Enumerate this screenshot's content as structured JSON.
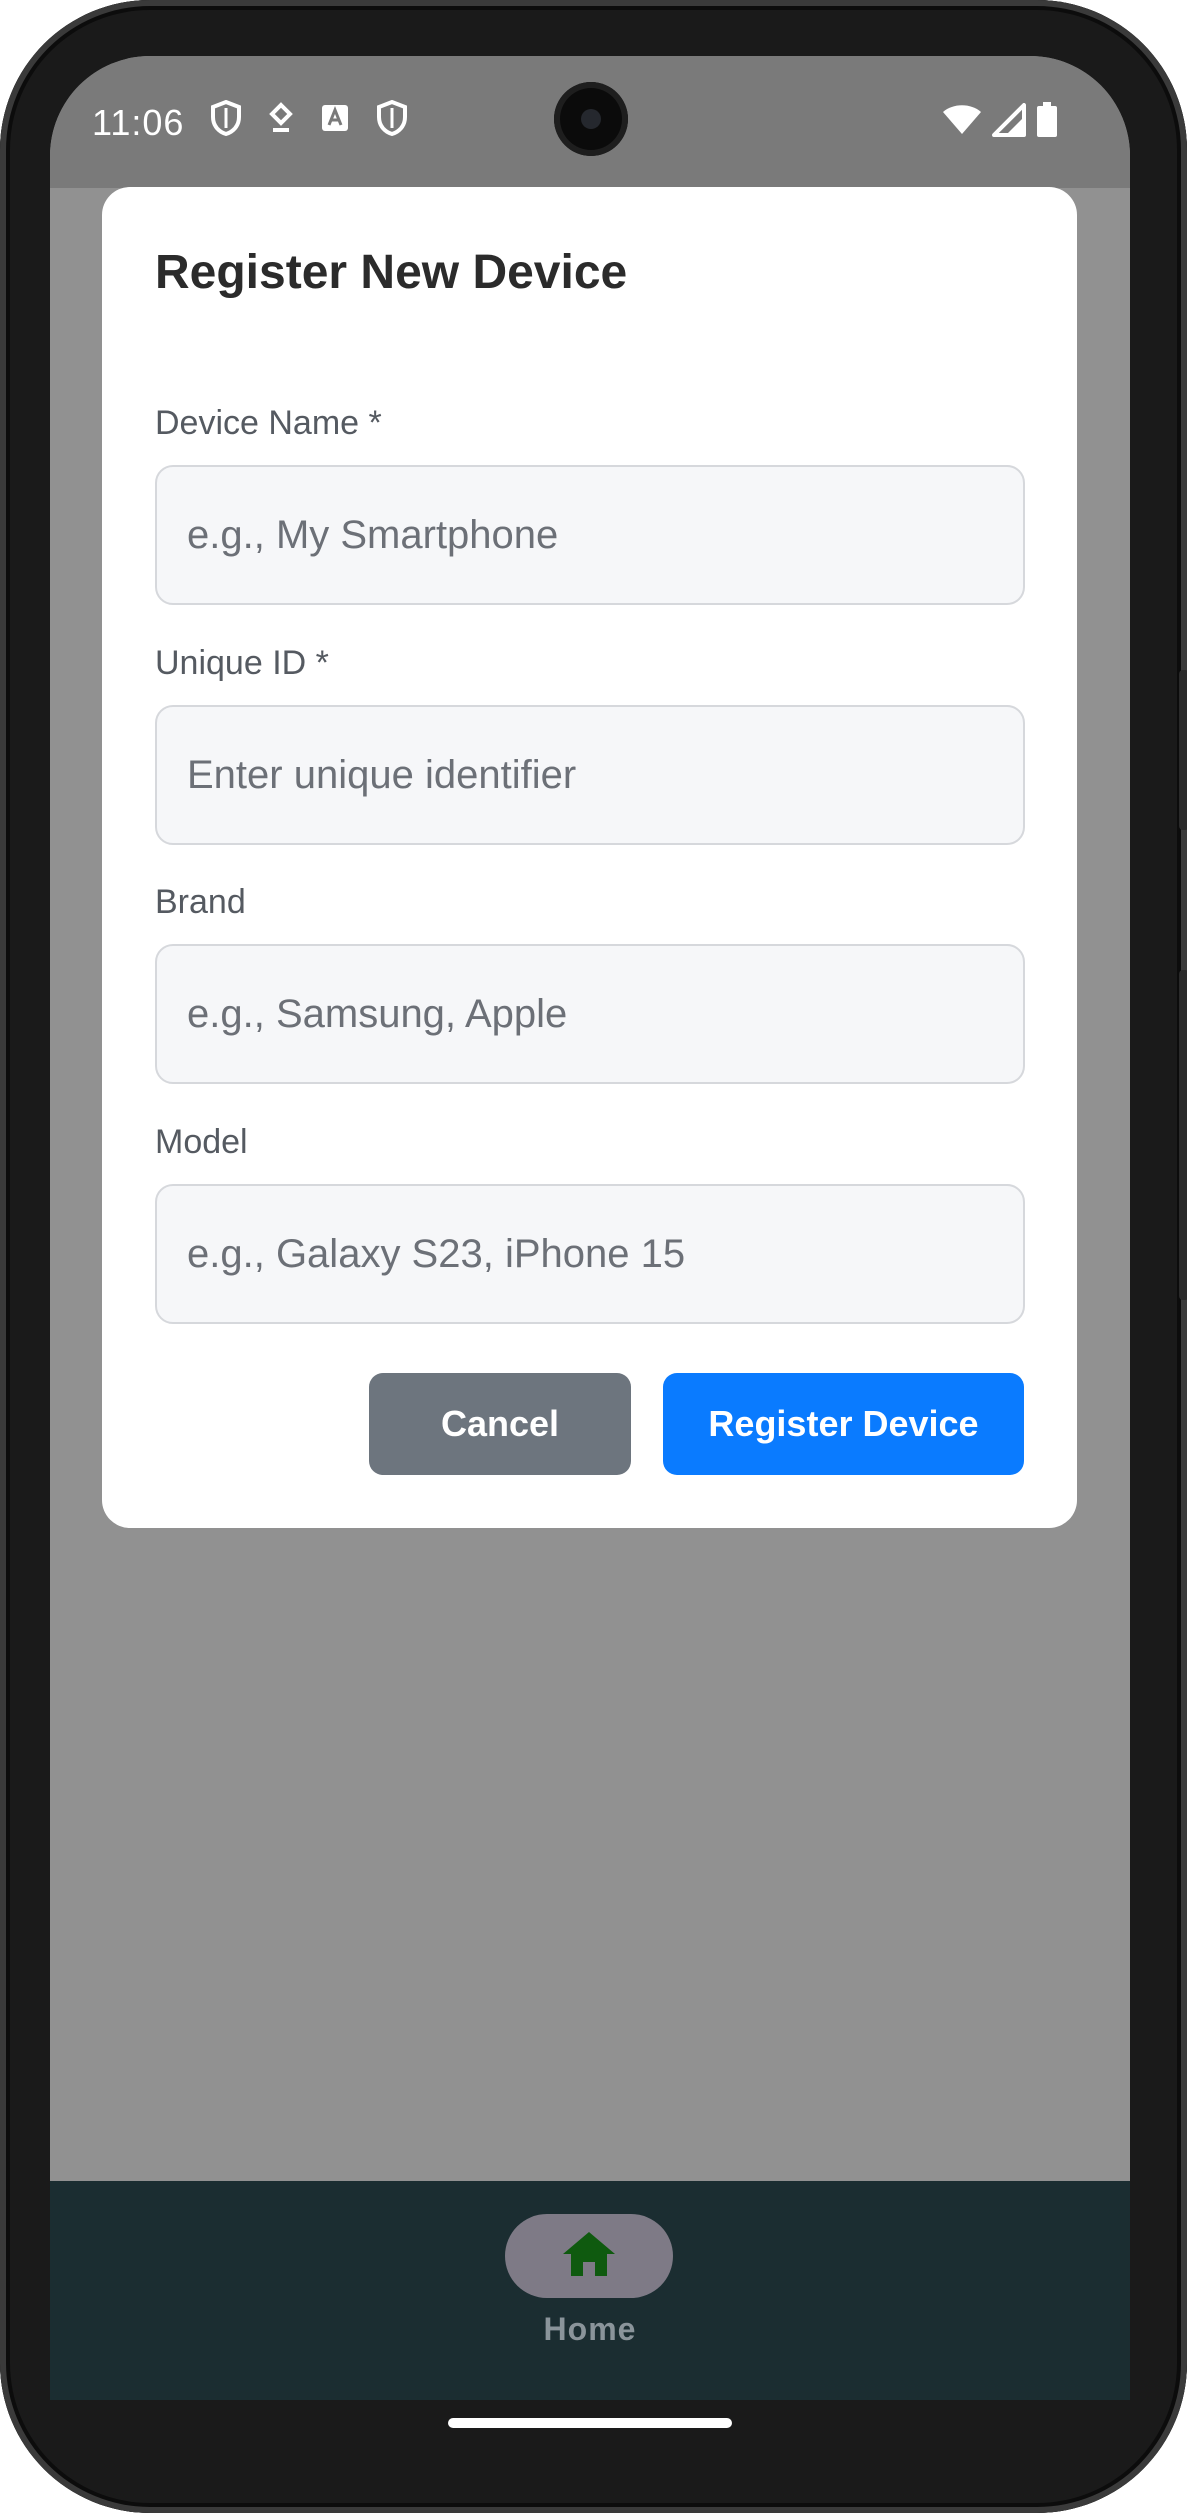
{
  "status_bar": {
    "time": "11:06",
    "left_icons": [
      "shield-icon",
      "location-icon",
      "text-recognition-icon",
      "shield-icon"
    ],
    "right_icons": [
      "wifi-icon",
      "signal-icon",
      "battery-icon"
    ]
  },
  "dialog": {
    "title": "Register New Device",
    "fields": [
      {
        "label": "Device Name *",
        "placeholder": "e.g., My Smartphone",
        "value": ""
      },
      {
        "label": "Unique ID *",
        "placeholder": "Enter unique identifier",
        "value": ""
      },
      {
        "label": "Brand",
        "placeholder": "e.g., Samsung, Apple",
        "value": ""
      },
      {
        "label": "Model",
        "placeholder": "e.g., Galaxy S23, iPhone 15",
        "value": ""
      }
    ],
    "cancel_label": "Cancel",
    "submit_label": "Register Device"
  },
  "bottom_nav": {
    "items": [
      {
        "label": "Home",
        "icon": "home-icon",
        "active": true
      }
    ]
  },
  "colors": {
    "primary": "#0a7bff",
    "secondary": "#6d757e",
    "nav_background": "#1b2d31",
    "scrim": "#919191",
    "home_icon": "#0f5a0f"
  }
}
